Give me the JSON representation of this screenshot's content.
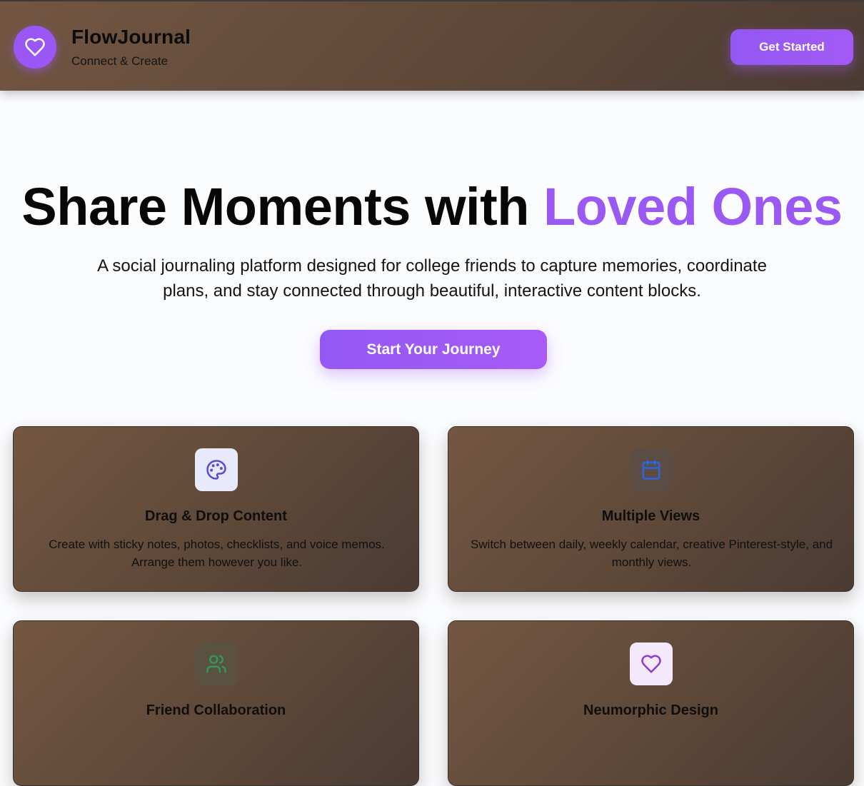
{
  "header": {
    "brand_name": "FlowJournal",
    "brand_tagline": "Connect & Create",
    "cta_label": "Get Started",
    "logo_icon": "heart-icon"
  },
  "hero": {
    "title_main": "Share Moments with ",
    "title_accent": "Loved Ones",
    "subtitle": "A social journaling platform designed for college friends to capture memories, coordinate plans, and stay connected through beautiful, interactive content blocks.",
    "cta_label": "Start Your Journey"
  },
  "features": [
    {
      "title": "Drag & Drop Content",
      "description": "Create with sticky notes, photos, checklists, and voice memos. Arrange them however you like.",
      "icon": "palette-icon",
      "icon_bg": "#e8e9fb",
      "icon_color": "#5a48d6"
    },
    {
      "title": "Multiple Views",
      "description": "Switch between daily, weekly calendar, creative Pinterest-style, and monthly views.",
      "icon": "calendar-icon",
      "icon_bg": "#5b4c44",
      "icon_color": "#2f63e0"
    },
    {
      "title": "Friend Collaboration",
      "description": "",
      "icon": "users-icon",
      "icon_bg": "#5b5141",
      "icon_color": "#2f9c56"
    },
    {
      "title": "Neumorphic Design",
      "description": "",
      "icon": "heart-icon",
      "icon_bg": "#f3e8fc",
      "icon_color": "#8d3bd4"
    }
  ],
  "colors": {
    "accent": "#9b59f4",
    "header_bg": "#6a503e",
    "card_bg": "#5e4838",
    "page_bg": "#fbfcfe"
  }
}
